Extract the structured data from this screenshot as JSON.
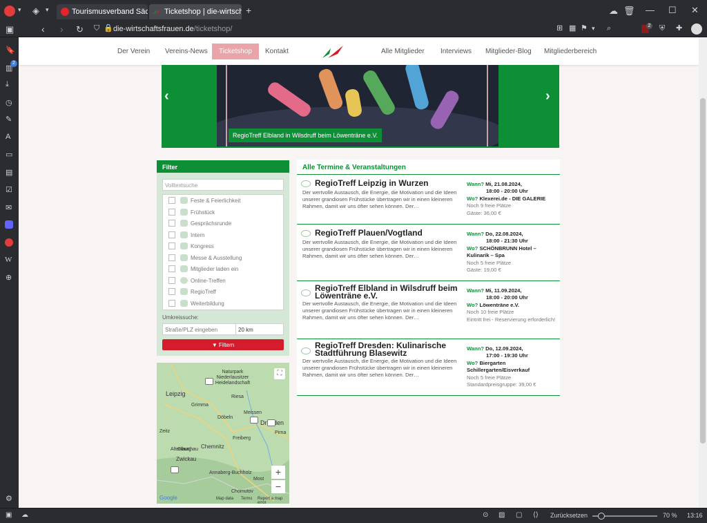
{
  "browser": {
    "tabs": [
      {
        "label": "Tourismusverband Sächsisch"
      },
      {
        "label": "Ticketshop | die-wirtschafts"
      }
    ],
    "url_host": "die-wirtschaftsfrauen.de",
    "url_path": "/ticketshop/",
    "panel_badge": "2",
    "ext_badge": "2",
    "status": {
      "reset_label": "Zurücksetzen",
      "zoom": "70 %",
      "clock": "13:16"
    }
  },
  "site": {
    "nav": [
      "Der Verein",
      "Vereins-News",
      "Ticketshop",
      "Kontakt",
      "Alle Mitglieder",
      "Interviews",
      "Mitglieder-Blog",
      "Mitgliederbereich"
    ],
    "slider_caption": "RegioTreff Elbland in Wilsdruff beim Löwenträne e.V.",
    "filter": {
      "title": "Filter",
      "search_placeholder": "Volltextsuche",
      "categories": [
        "Feste & Feierlichkeit",
        "Frühstück",
        "Gesprächsrunde",
        "Intern",
        "Kongress",
        "Messe & Ausstellung",
        "Mitglieder laden ein",
        "Online-Treffen",
        "RegioTreff",
        "Weiterbildung"
      ],
      "radius_label": "Umkreissuche:",
      "plz_placeholder": "Straße/PLZ eingeben",
      "km_value": "20 km",
      "button": "Filtern"
    },
    "map": {
      "labels": [
        "Naturpark Niederlausitzer Heidelandschaft",
        "Leipzig",
        "Riesa",
        "Grimma",
        "Meissen",
        "Döbeln",
        "Dresden",
        "Zeitz",
        "Altenburg",
        "Freiberg",
        "Pirna",
        "Glauchau",
        "Chemnitz",
        "Zwickau",
        "Annaberg-Buchholz",
        "Most",
        "Chomutov"
      ],
      "footer": [
        "Google",
        "Map data",
        "Terms",
        "Report a map error"
      ],
      "zoom_in": "+",
      "zoom_out": "−"
    },
    "events_title": "Alle Termine & Veranstaltungen",
    "events": [
      {
        "title": "RegioTreff Leipzig in Wurzen",
        "desc": "Der wertvolle Austausch, die Energie, die Motivation und die Ideen unserer grandiosen Frühstücke übertragen wir in einen kleineren Rahmen, damit wir uns öfter sehen können. Der…",
        "wann_label": "Wann?",
        "wann": "Mi, 21.08.2024,",
        "time": "18:00 - 20:00 Uhr",
        "wo_label": "Wo?",
        "wo": "Klexerei.de - DIE GALERIE",
        "seats": "Noch 9 freie Plätze",
        "price": "Gäste: 36,00 €"
      },
      {
        "title": "RegioTreff Plauen/Vogtland",
        "desc": "Der wertvolle Austausch, die Energie, die Motivation und die Ideen unserer grandiosen Frühstücke übertragen wir in einen kleineren Rahmen, damit wir uns öfter sehen können. Der…",
        "wann_label": "Wann?",
        "wann": "Do, 22.08.2024,",
        "time": "18:00 - 21:30 Uhr",
        "wo_label": "Wo?",
        "wo": "SCHÖNBRUNN Hotel – Kulinarik – Spa",
        "seats": "Noch 5 freie Plätze",
        "price": "Gäste: 19,00 €"
      },
      {
        "title": "RegioTreff Elbland in Wilsdruff beim Löwenträne e.V.",
        "desc": "Der wertvolle Austausch, die Energie, die Motivation und die Ideen unserer grandiosen Frühstücke übertragen wir in einen kleineren Rahmen, damit wir uns öfter sehen können. Der…",
        "wann_label": "Wann?",
        "wann": "Mi, 11.09.2024,",
        "time": "18:00 - 20:00 Uhr",
        "wo_label": "Wo?",
        "wo": "Löwenträne e.V.",
        "seats": "Noch 10 freie Plätze",
        "price": "Eintritt frei - Reservierung erforderlich!"
      },
      {
        "title": "RegioTreff Dresden: Kulinarische Stadtführung Blasewitz",
        "desc": "Der wertvolle Austausch, die Energie, die Motivation und die Ideen unserer grandiosen Frühstücke übertragen wir in einen kleineren Rahmen, damit wir uns öfter sehen können. Der…",
        "wann_label": "Wann?",
        "wann": "Do, 12.09.2024,",
        "time": "17:00 - 19:30 Uhr",
        "wo_label": "Wo?",
        "wo": "Biergarten Schillergarten/Eisverkauf",
        "seats": "Noch 5 freie Plätze",
        "price": "Standardpreisgruppe: 39,00 €"
      }
    ]
  },
  "colors": {
    "brand_green": "#0d8f36",
    "brand_red": "#d41c2c",
    "active_nav": "#e8a4a8"
  }
}
